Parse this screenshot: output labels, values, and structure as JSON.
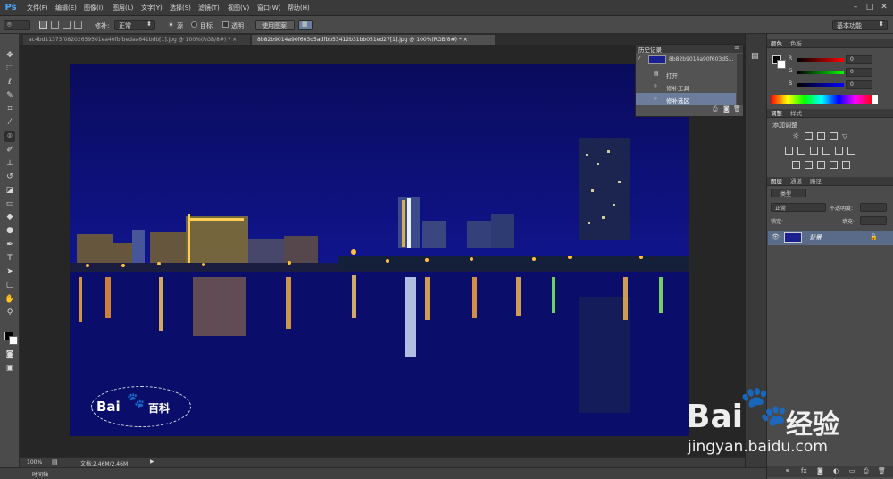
{
  "app": {
    "logo": "Ps",
    "workspace": "基本功能"
  },
  "menu": [
    "文件(F)",
    "编辑(E)",
    "图像(I)",
    "图层(L)",
    "文字(Y)",
    "选择(S)",
    "滤镜(T)",
    "视图(V)",
    "窗口(W)",
    "帮助(H)"
  ],
  "window_controls": {
    "minimize": "–",
    "maximize": "□",
    "close": "✕"
  },
  "options": {
    "patch_label": "修补:",
    "mode_value": "正常",
    "source_label": "源",
    "target_label": "目标",
    "transparent_label": "透明",
    "use_pattern_label": "使用图案"
  },
  "tabs": [
    {
      "label": "ac4bd11373f08202659501ea40fbfbedaa641bdb[1].jpg @ 100%(RGB/8#) *",
      "close": "×"
    },
    {
      "label": "8b82b9014a90f603d5adfbb53412b31bb051ed27[1].jpg @ 100%(RGB/8#) *",
      "close": "×"
    }
  ],
  "history": {
    "title": "历史记录",
    "snapshot": "8b82b9014a90f603d5...",
    "items": [
      "打开",
      "修补工具",
      "修补选区"
    ]
  },
  "status": {
    "zoom": "100%",
    "doc": "文档:2.46M/2.46M"
  },
  "timeline": {
    "label": "时间轴"
  },
  "color_panel": {
    "tabs": [
      "颜色",
      "色板"
    ],
    "r_label": "R",
    "g_label": "G",
    "b_label": "B",
    "r": "0",
    "g": "0",
    "b": "0"
  },
  "adjust_panel": {
    "tabs": [
      "调整",
      "样式"
    ],
    "title": "添加调整"
  },
  "layers_panel": {
    "tabs": [
      "图层",
      "通道",
      "路径"
    ],
    "kind": "类型",
    "blend": "正常",
    "opacity_label": "不透明度:",
    "lock_label": "锁定:",
    "fill_label": "填充:",
    "layer_name": "背景"
  },
  "watermark_image": {
    "brand": "Bai",
    "brand2": "百科"
  },
  "watermark_screen": {
    "brand": "Bai",
    "cn": "经验",
    "url": "jingyan.baidu.com"
  },
  "colors": {
    "sky": "#0e128a",
    "accent": "#4aa8ff"
  }
}
